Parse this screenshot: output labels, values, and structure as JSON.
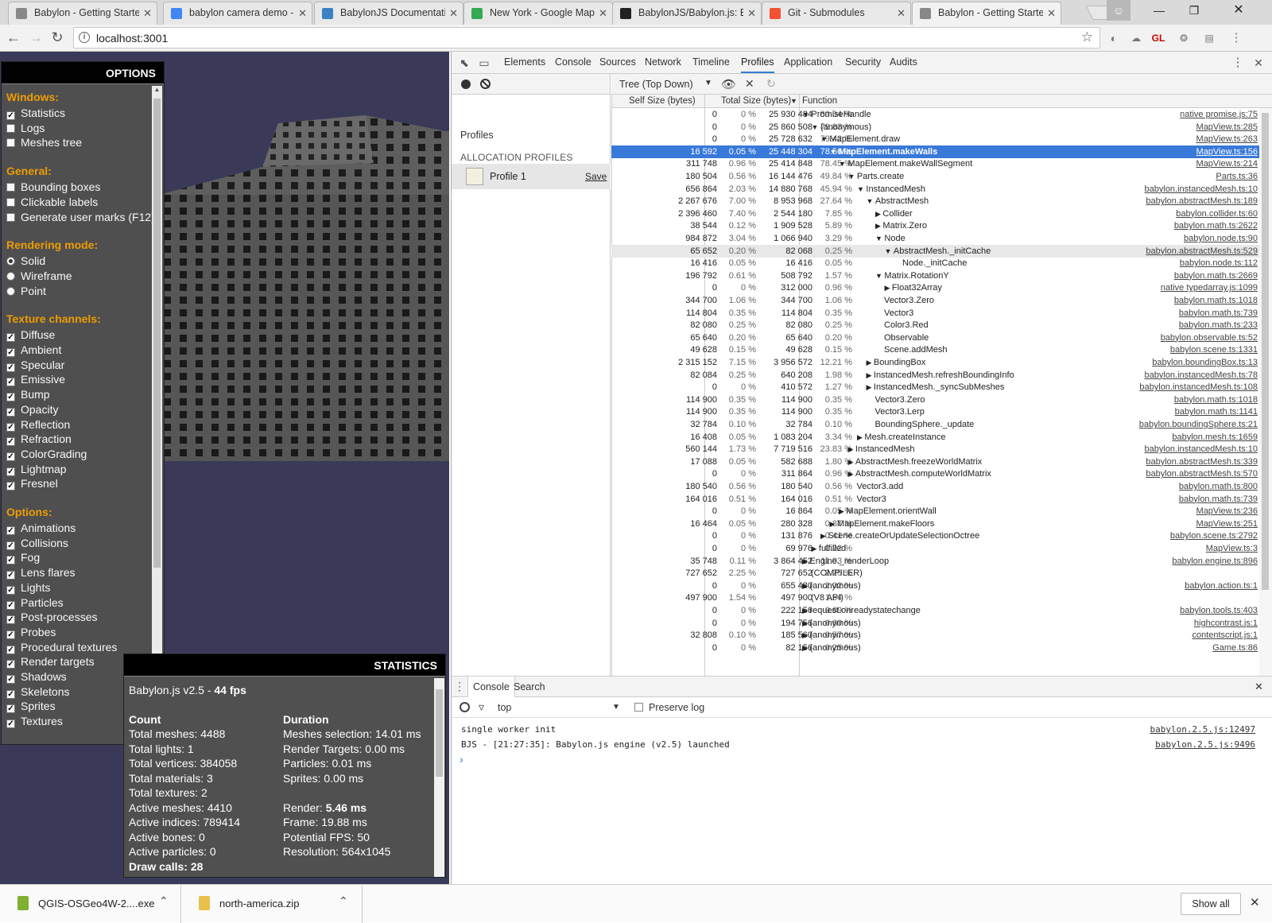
{
  "browser": {
    "tabs": [
      {
        "title": "Babylon - Getting Started",
        "icon": "page-icon",
        "color": "#888888"
      },
      {
        "title": "babylon camera demo -",
        "icon": "google-icon",
        "color": "#4285f4"
      },
      {
        "title": "BabylonJS Documentation",
        "icon": "babylon-icon",
        "color": "#3b82c4"
      },
      {
        "title": "New York - Google Maps",
        "icon": "maps-icon",
        "color": "#34a853"
      },
      {
        "title": "BabylonJS/Babylon.js: Ba",
        "icon": "github-icon",
        "color": "#222222"
      },
      {
        "title": "Git - Submodules",
        "icon": "git-icon",
        "color": "#f05133"
      },
      {
        "title": "Babylon - Getting Started",
        "icon": "page-icon",
        "color": "#888888",
        "active": true
      }
    ],
    "url": "localhost:3001"
  },
  "options_panel": {
    "title": "OPTIONS",
    "sections": [
      {
        "heading": "Windows:",
        "type": "checkbox",
        "items": [
          {
            "label": "Statistics",
            "checked": true
          },
          {
            "label": "Logs",
            "checked": false
          },
          {
            "label": "Meshes tree",
            "checked": false
          }
        ]
      },
      {
        "heading": "General:",
        "type": "checkbox",
        "items": [
          {
            "label": "Bounding boxes",
            "checked": false
          },
          {
            "label": "Clickable labels",
            "checked": false
          },
          {
            "label": "Generate user marks (F12)",
            "checked": false
          }
        ]
      },
      {
        "heading": "Rendering mode:",
        "type": "radio",
        "items": [
          {
            "label": "Solid",
            "checked": true
          },
          {
            "label": "Wireframe",
            "checked": false
          },
          {
            "label": "Point",
            "checked": false
          }
        ]
      },
      {
        "heading": "Texture channels:",
        "type": "checkbox",
        "items": [
          {
            "label": "Diffuse",
            "checked": true
          },
          {
            "label": "Ambient",
            "checked": true
          },
          {
            "label": "Specular",
            "checked": true
          },
          {
            "label": "Emissive",
            "checked": true
          },
          {
            "label": "Bump",
            "checked": true
          },
          {
            "label": "Opacity",
            "checked": true
          },
          {
            "label": "Reflection",
            "checked": true
          },
          {
            "label": "Refraction",
            "checked": true
          },
          {
            "label": "ColorGrading",
            "checked": true
          },
          {
            "label": "Lightmap",
            "checked": true
          },
          {
            "label": "Fresnel",
            "checked": true
          }
        ]
      },
      {
        "heading": "Options:",
        "type": "checkbox",
        "items": [
          {
            "label": "Animations",
            "checked": true
          },
          {
            "label": "Collisions",
            "checked": true
          },
          {
            "label": "Fog",
            "checked": true
          },
          {
            "label": "Lens flares",
            "checked": true
          },
          {
            "label": "Lights",
            "checked": true
          },
          {
            "label": "Particles",
            "checked": true
          },
          {
            "label": "Post-processes",
            "checked": true
          },
          {
            "label": "Probes",
            "checked": true
          },
          {
            "label": "Procedural textures",
            "checked": true
          },
          {
            "label": "Render targets",
            "checked": true
          },
          {
            "label": "Shadows",
            "checked": true
          },
          {
            "label": "Skeletons",
            "checked": true
          },
          {
            "label": "Sprites",
            "checked": true
          },
          {
            "label": "Textures",
            "checked": true
          }
        ]
      }
    ]
  },
  "statistics_panel": {
    "title": "STATISTICS",
    "version_prefix": "Babylon.js v2.5 - ",
    "fps": "44 fps",
    "count_heading": "Count",
    "duration_heading": "Duration",
    "count": [
      "Total meshes: 4488",
      "Total lights: 1",
      "Total vertices: 384058",
      "Total materials: 3",
      "Total textures: 2",
      "Active meshes: 4410",
      "Active indices: 789414",
      "Active bones: 0",
      "Active particles: 0",
      "Draw calls: 28"
    ],
    "duration": [
      {
        "label": "Meshes selection: 14.01 ms"
      },
      {
        "label": "Render Targets: 0.00 ms"
      },
      {
        "label": "Particles: 0.01 ms"
      },
      {
        "label": "Sprites: 0.00 ms"
      },
      {
        "label": ""
      },
      {
        "label": "Render: ",
        "bold": "5.46 ms"
      },
      {
        "label": "Frame: 19.88 ms"
      },
      {
        "label": "Potential FPS: 50"
      },
      {
        "label": "Resolution: 564x1045"
      }
    ]
  },
  "devtools": {
    "tabs": [
      "Elements",
      "Console",
      "Sources",
      "Network",
      "Timeline",
      "Profiles",
      "Application",
      "Security",
      "Audits"
    ],
    "active_tab": "Profiles",
    "profiles_label": "Profiles",
    "allocation_group": "ALLOCATION PROFILES",
    "profile_name": "Profile 1",
    "save_label": "Save",
    "view_mode": "Tree (Top Down)",
    "columns": {
      "self": "Self Size (bytes)",
      "total": "Total Size (bytes)",
      "function": "Function"
    },
    "rows": [
      {
        "self": "0",
        "selfp": "0 %",
        "total": "25 930 484",
        "totalp": "80.04 %",
        "depth": 0,
        "arrow": "down",
        "fn": "PromiseHandle",
        "src": "native promise.js:75"
      },
      {
        "self": "0",
        "selfp": "0 %",
        "total": "25 860 508",
        "totalp": "79.83 %",
        "depth": 1,
        "arrow": "down",
        "fn": "(anonymous)",
        "src": "MapView.ts:285"
      },
      {
        "self": "0",
        "selfp": "0 %",
        "total": "25 728 632",
        "totalp": "79.42 %",
        "depth": 2,
        "arrow": "down",
        "fn": "MapElement.draw",
        "src": "MapView.ts:263"
      },
      {
        "self": "16 592",
        "selfp": "0.05 %",
        "total": "25 448 304",
        "totalp": "78.56 %",
        "depth": 3,
        "arrow": "down",
        "fn": "MapElement.makeWalls",
        "src": "MapView.ts:156",
        "selected": true
      },
      {
        "self": "311 748",
        "selfp": "0.96 %",
        "total": "25 414 848",
        "totalp": "78.45 %",
        "depth": 4,
        "arrow": "down",
        "fn": "MapElement.makeWallSegment",
        "src": "MapView.ts:214"
      },
      {
        "self": "180 504",
        "selfp": "0.56 %",
        "total": "16 144 476",
        "totalp": "49.84 %",
        "depth": 5,
        "arrow": "down",
        "fn": "Parts.create",
        "src": "Parts.ts:36"
      },
      {
        "self": "656 864",
        "selfp": "2.03 %",
        "total": "14 880 768",
        "totalp": "45.94 %",
        "depth": 6,
        "arrow": "down",
        "fn": "InstancedMesh",
        "src": "babylon.instancedMesh.ts:10"
      },
      {
        "self": "2 267 676",
        "selfp": "7.00 %",
        "total": "8 953 968",
        "totalp": "27.64 %",
        "depth": 7,
        "arrow": "down",
        "fn": "AbstractMesh",
        "src": "babylon.abstractMesh.ts:189"
      },
      {
        "self": "2 396 460",
        "selfp": "7.40 %",
        "total": "2 544 180",
        "totalp": "7.85 %",
        "depth": 8,
        "arrow": "right",
        "fn": "Collider",
        "src": "babylon.collider.ts:60"
      },
      {
        "self": "38 544",
        "selfp": "0.12 %",
        "total": "1 909 528",
        "totalp": "5.89 %",
        "depth": 8,
        "arrow": "right",
        "fn": "Matrix.Zero",
        "src": "babylon.math.ts:2622"
      },
      {
        "self": "984 872",
        "selfp": "3.04 %",
        "total": "1 066 940",
        "totalp": "3.29 %",
        "depth": 8,
        "arrow": "down",
        "fn": "Node",
        "src": "babylon.node.ts:90"
      },
      {
        "self": "65 652",
        "selfp": "0.20 %",
        "total": "82 068",
        "totalp": "0.25 %",
        "depth": 9,
        "arrow": "down",
        "fn": "AbstractMesh._initCache",
        "src": "babylon.abstractMesh.ts:529",
        "hover": true
      },
      {
        "self": "16 416",
        "selfp": "0.05 %",
        "total": "16 416",
        "totalp": "0.05 %",
        "depth": 10,
        "arrow": "",
        "fn": "Node._initCache",
        "src": "babylon.node.ts:112"
      },
      {
        "self": "196 792",
        "selfp": "0.61 %",
        "total": "508 792",
        "totalp": "1.57 %",
        "depth": 8,
        "arrow": "down",
        "fn": "Matrix.RotationY",
        "src": "babylon.math.ts:2669"
      },
      {
        "self": "0",
        "selfp": "0 %",
        "total": "312 000",
        "totalp": "0.96 %",
        "depth": 9,
        "arrow": "right",
        "fn": "Float32Array",
        "src": "native typedarray.js:1099"
      },
      {
        "self": "344 700",
        "selfp": "1.06 %",
        "total": "344 700",
        "totalp": "1.06 %",
        "depth": 8,
        "arrow": "",
        "fn": "Vector3.Zero",
        "src": "babylon.math.ts:1018"
      },
      {
        "self": "114 804",
        "selfp": "0.35 %",
        "total": "114 804",
        "totalp": "0.35 %",
        "depth": 8,
        "arrow": "",
        "fn": "Vector3",
        "src": "babylon.math.ts:739"
      },
      {
        "self": "82 080",
        "selfp": "0.25 %",
        "total": "82 080",
        "totalp": "0.25 %",
        "depth": 8,
        "arrow": "",
        "fn": "Color3.Red",
        "src": "babylon.math.ts:233"
      },
      {
        "self": "65 640",
        "selfp": "0.20 %",
        "total": "65 640",
        "totalp": "0.20 %",
        "depth": 8,
        "arrow": "",
        "fn": "Observable",
        "src": "babylon.observable.ts:52"
      },
      {
        "self": "49 628",
        "selfp": "0.15 %",
        "total": "49 628",
        "totalp": "0.15 %",
        "depth": 8,
        "arrow": "",
        "fn": "Scene.addMesh",
        "src": "babylon.scene.ts:1331"
      },
      {
        "self": "2 315 152",
        "selfp": "7.15 %",
        "total": "3 956 572",
        "totalp": "12.21 %",
        "depth": 7,
        "arrow": "right",
        "fn": "BoundingBox",
        "src": "babylon.boundingBox.ts:13"
      },
      {
        "self": "82 084",
        "selfp": "0.25 %",
        "total": "640 208",
        "totalp": "1.98 %",
        "depth": 7,
        "arrow": "right",
        "fn": "InstancedMesh.refreshBoundingInfo",
        "src": "babylon.instancedMesh.ts:78"
      },
      {
        "self": "0",
        "selfp": "0 %",
        "total": "410 572",
        "totalp": "1.27 %",
        "depth": 7,
        "arrow": "right",
        "fn": "InstancedMesh._syncSubMeshes",
        "src": "babylon.instancedMesh.ts:108"
      },
      {
        "self": "114 900",
        "selfp": "0.35 %",
        "total": "114 900",
        "totalp": "0.35 %",
        "depth": 7,
        "arrow": "",
        "fn": "Vector3.Zero",
        "src": "babylon.math.ts:1018"
      },
      {
        "self": "114 900",
        "selfp": "0.35 %",
        "total": "114 900",
        "totalp": "0.35 %",
        "depth": 7,
        "arrow": "",
        "fn": "Vector3.Lerp",
        "src": "babylon.math.ts:1141"
      },
      {
        "self": "32 784",
        "selfp": "0.10 %",
        "total": "32 784",
        "totalp": "0.10 %",
        "depth": 7,
        "arrow": "",
        "fn": "BoundingSphere._update",
        "src": "babylon.boundingSphere.ts:21"
      },
      {
        "self": "16 408",
        "selfp": "0.05 %",
        "total": "1 083 204",
        "totalp": "3.34 %",
        "depth": 6,
        "arrow": "right",
        "fn": "Mesh.createInstance",
        "src": "babylon.mesh.ts:1659"
      },
      {
        "self": "560 144",
        "selfp": "1.73 %",
        "total": "7 719 516",
        "totalp": "23.83 %",
        "depth": 5,
        "arrow": "right",
        "fn": "InstancedMesh",
        "src": "babylon.instancedMesh.ts:10"
      },
      {
        "self": "17 088",
        "selfp": "0.05 %",
        "total": "582 688",
        "totalp": "1.80 %",
        "depth": 5,
        "arrow": "right",
        "fn": "AbstractMesh.freezeWorldMatrix",
        "src": "babylon.abstractMesh.ts:339"
      },
      {
        "self": "0",
        "selfp": "0 %",
        "total": "311 864",
        "totalp": "0.96 %",
        "depth": 5,
        "arrow": "right",
        "fn": "AbstractMesh.computeWorldMatrix",
        "src": "babylon.abstractMesh.ts:570"
      },
      {
        "self": "180 540",
        "selfp": "0.56 %",
        "total": "180 540",
        "totalp": "0.56 %",
        "depth": 5,
        "arrow": "",
        "fn": "Vector3.add",
        "src": "babylon.math.ts:800"
      },
      {
        "self": "164 016",
        "selfp": "0.51 %",
        "total": "164 016",
        "totalp": "0.51 %",
        "depth": 5,
        "arrow": "",
        "fn": "Vector3",
        "src": "babylon.math.ts:739"
      },
      {
        "self": "0",
        "selfp": "0 %",
        "total": "16 864",
        "totalp": "0.05 %",
        "depth": 4,
        "arrow": "right",
        "fn": "MapElement.orientWall",
        "src": "MapView.ts:236"
      },
      {
        "self": "16 464",
        "selfp": "0.05 %",
        "total": "280 328",
        "totalp": "0.87 %",
        "depth": 3,
        "arrow": "right",
        "fn": "MapElement.makeFloors",
        "src": "MapView.ts:251"
      },
      {
        "self": "0",
        "selfp": "0 %",
        "total": "131 876",
        "totalp": "0.41 %",
        "depth": 2,
        "arrow": "right",
        "fn": "Scene.createOrUpdateSelectionOctree",
        "src": "babylon.scene.ts:2792"
      },
      {
        "self": "0",
        "selfp": "0 %",
        "total": "69 976",
        "totalp": "0.22 %",
        "depth": 1,
        "arrow": "right",
        "fn": "fulfilled",
        "src": "MapView.ts:3"
      },
      {
        "self": "35 748",
        "selfp": "0.11 %",
        "total": "3 864 452",
        "totalp": "11.93 %",
        "depth": 0,
        "arrow": "right",
        "fn": "Engine._renderLoop",
        "src": "babylon.engine.ts:896"
      },
      {
        "self": "727 652",
        "selfp": "2.25 %",
        "total": "727 652",
        "totalp": "2.25 %",
        "depth": 0,
        "arrow": "",
        "fn": "(COMPILER)",
        "src": ""
      },
      {
        "self": "0",
        "selfp": "0 %",
        "total": "655 480",
        "totalp": "2.02 %",
        "depth": 0,
        "arrow": "right",
        "fn": "(anonymous)",
        "src": "babylon.action.ts:1"
      },
      {
        "self": "497 900",
        "selfp": "1.54 %",
        "total": "497 900",
        "totalp": "1.54 %",
        "depth": 0,
        "arrow": "",
        "fn": "(V8 API)",
        "src": ""
      },
      {
        "self": "0",
        "selfp": "0 %",
        "total": "222 156",
        "totalp": "0.69 %",
        "depth": 0,
        "arrow": "right",
        "fn": "request.onreadystatechange",
        "src": "babylon.tools.ts:403"
      },
      {
        "self": "0",
        "selfp": "0 %",
        "total": "194 756",
        "totalp": "0.60 %",
        "depth": 0,
        "arrow": "right",
        "fn": "(anonymous)",
        "src": "highcontrast.js:1"
      },
      {
        "self": "32 808",
        "selfp": "0.10 %",
        "total": "185 560",
        "totalp": "0.57 %",
        "depth": 0,
        "arrow": "right",
        "fn": "(anonymous)",
        "src": "contentscript.js:1"
      },
      {
        "self": "0",
        "selfp": "0 %",
        "total": "82 156",
        "totalp": "0.25 %",
        "depth": 0,
        "arrow": "right",
        "fn": "(anonymous)",
        "src": "Game.ts:86"
      }
    ],
    "drawer_tabs": [
      "Console",
      "Search"
    ],
    "context": "top",
    "preserve_log": "Preserve log",
    "console": [
      {
        "msg": "single worker init",
        "src": "babylon.2.5.js:12497"
      },
      {
        "msg": "BJS - [21:27:35]: Babylon.js engine (v2.5) launched",
        "src": "babylon.2.5.js:9496"
      }
    ]
  },
  "downloads": {
    "items": [
      {
        "name": "QGIS-OSGeo4W-2....exe",
        "color": "#7fb030"
      },
      {
        "name": "north-america.zip",
        "color": "#e8c04a"
      }
    ],
    "show_all": "Show all"
  }
}
